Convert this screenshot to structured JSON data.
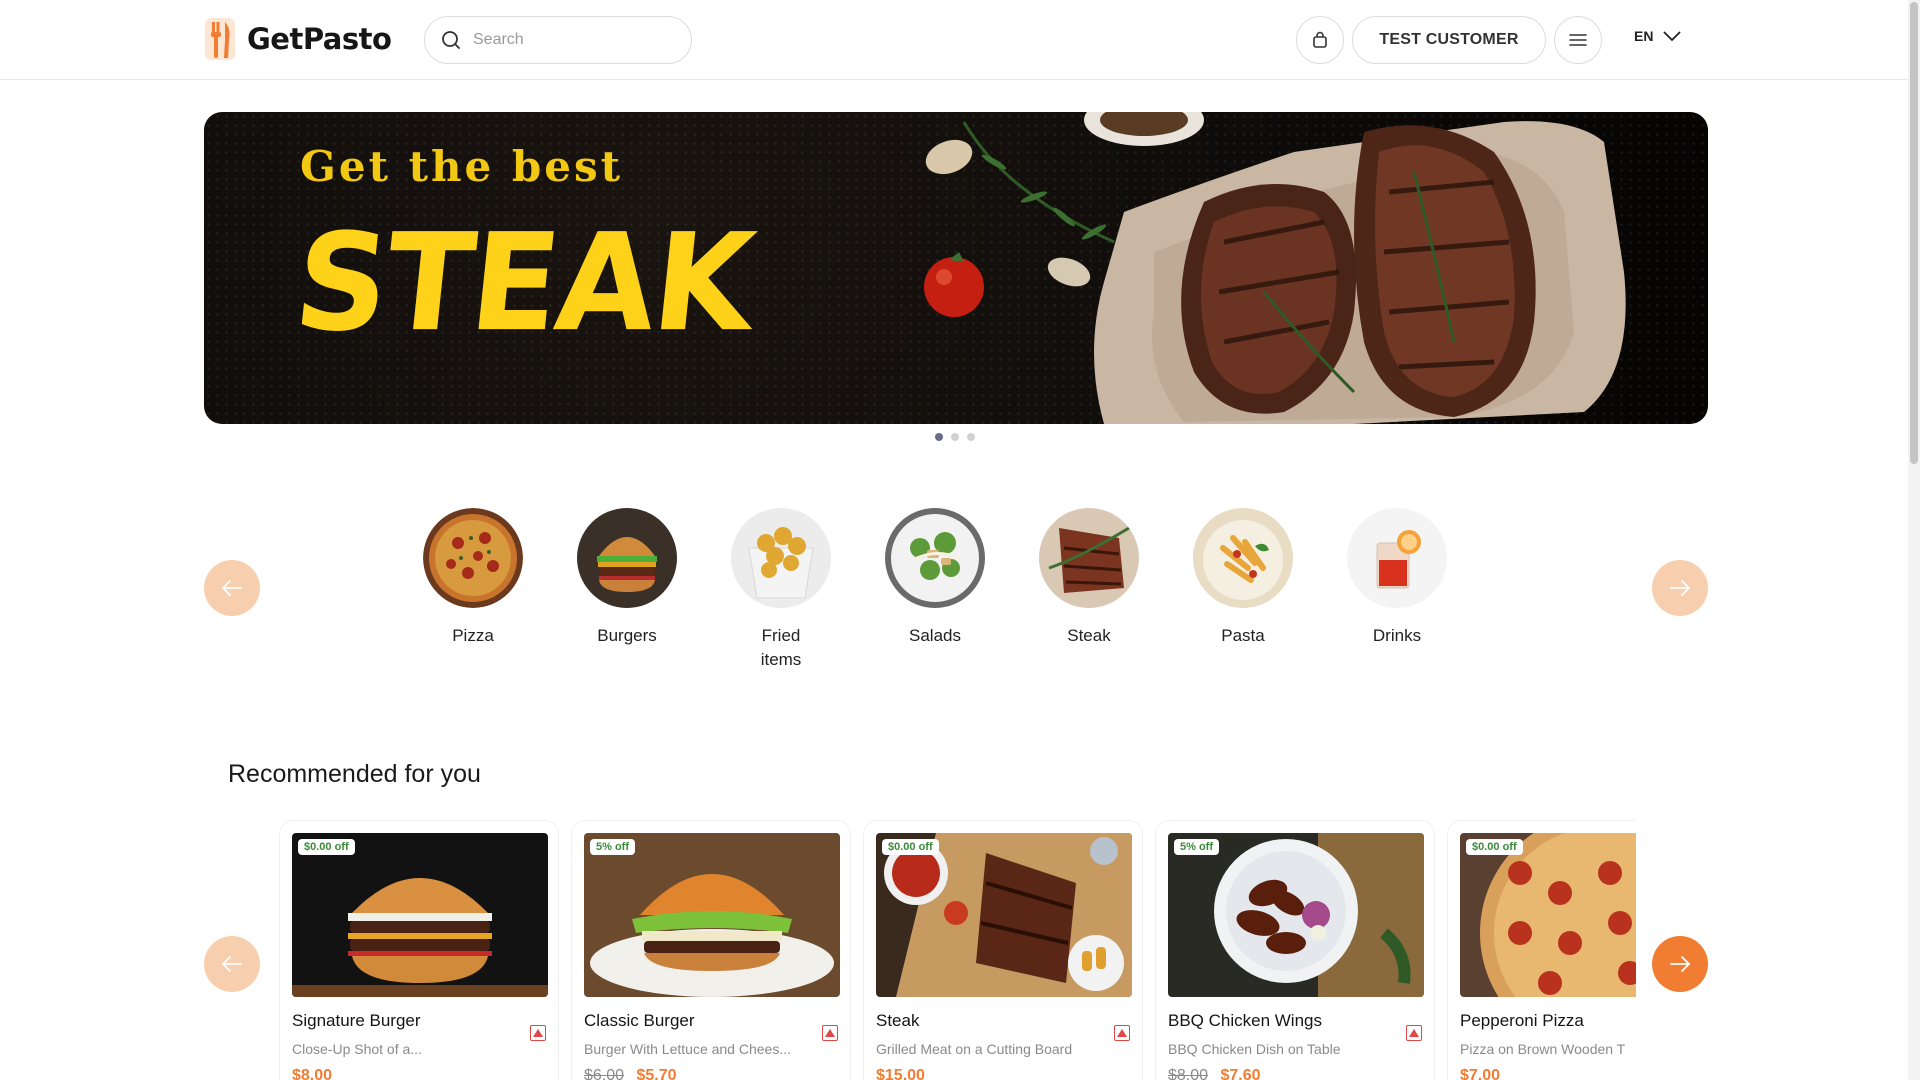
{
  "header": {
    "brand": "GetPasto",
    "search_placeholder": "Search",
    "account_label": "TEST CUSTOMER",
    "language": "EN"
  },
  "banner": {
    "headline": "Get the best",
    "title": "STEAK",
    "slides_total": 3,
    "active_slide": 1
  },
  "categories": [
    {
      "label": "Pizza"
    },
    {
      "label": "Burgers"
    },
    {
      "label": "Fried items"
    },
    {
      "label": "Salads"
    },
    {
      "label": "Steak"
    },
    {
      "label": "Pasta"
    },
    {
      "label": "Drinks"
    }
  ],
  "recommended": {
    "title": "Recommended for you",
    "items": [
      {
        "name": "Signature Burger",
        "description": "Close-Up Shot of a...",
        "badge": "$0.00 off",
        "old_price": "",
        "price": "$8.00"
      },
      {
        "name": "Classic Burger",
        "description": "Burger With Lettuce and Chees...",
        "badge": "5% off",
        "old_price": "$6.00",
        "price": "$5.70"
      },
      {
        "name": "Steak",
        "description": "Grilled Meat on a Cutting Board",
        "badge": "$0.00 off",
        "old_price": "",
        "price": "$15.00"
      },
      {
        "name": "BBQ Chicken Wings",
        "description": "BBQ Chicken Dish on Table",
        "badge": "5% off",
        "old_price": "$8.00",
        "price": "$7.60"
      },
      {
        "name": "Pepperoni Pizza",
        "description": "Pizza on Brown Wooden T",
        "badge": "$0.00 off",
        "old_price": "",
        "price": "$7.00"
      }
    ]
  },
  "colors": {
    "accent": "#f07d32",
    "accent_light": "#f7cfae",
    "banner_text": "#ffd21a",
    "discount_badge": "#3a8a3a"
  },
  "icons": [
    "fork-knife-logo-icon",
    "search-icon",
    "shopping-bag-icon",
    "hamburger-menu-icon",
    "chevron-down-icon",
    "arrow-left-icon",
    "arrow-right-icon",
    "favorite-icon"
  ]
}
